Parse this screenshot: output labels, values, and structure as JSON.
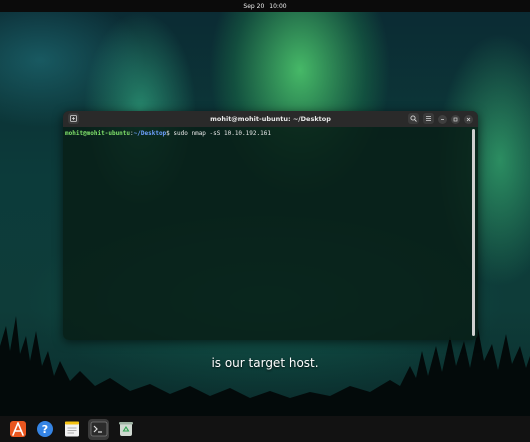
{
  "topbar": {
    "date": "Sep 20",
    "time": "10:00"
  },
  "window": {
    "title": "mohit@mohit-ubuntu: ~/Desktop",
    "new_tab_icon": "new-tab-icon",
    "search_icon": "search-icon",
    "menu_icon": "hamburger-menu-icon"
  },
  "terminal": {
    "user_host": "mohit@mohit-ubuntu",
    "sep": ":",
    "path": "~/Desktop",
    "prompt_symbol": "$",
    "command": " sudo nmap -sS 10.10.192.161"
  },
  "subtitle": "is our target host.",
  "dock": [
    {
      "name": "app-center",
      "icon": "app-store-icon"
    },
    {
      "name": "help",
      "icon": "help-icon"
    },
    {
      "name": "text-editor",
      "icon": "text-editor-icon"
    },
    {
      "name": "terminal",
      "icon": "terminal-icon",
      "active": true
    },
    {
      "name": "trash",
      "icon": "trash-icon"
    }
  ]
}
